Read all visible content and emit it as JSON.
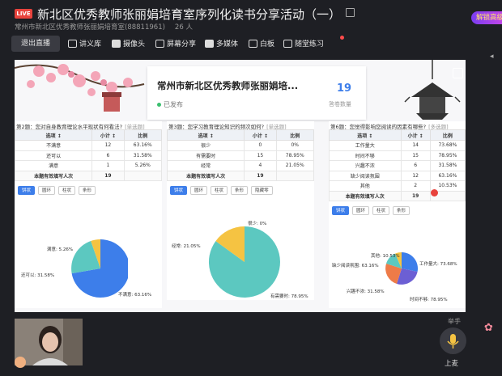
{
  "header": {
    "live_badge": "LIVE",
    "title": "新北区优秀教师张丽娟培育室序列化读书分享活动（一）",
    "room_name": "常州市新北区优秀教师张丽娟培育室",
    "room_id": "(88811961)",
    "viewer_count": "26 人",
    "promo_label": "解锁高级"
  },
  "toolbar": {
    "exit_label": "退出直播",
    "items": [
      {
        "label": "讲义库",
        "icon": "document-icon"
      },
      {
        "label": "摄像头",
        "icon": "camera-icon"
      },
      {
        "label": "屏幕分享",
        "icon": "screen-share-icon"
      },
      {
        "label": "多媒体",
        "icon": "play-icon"
      },
      {
        "label": "白板",
        "icon": "whiteboard-icon"
      },
      {
        "label": "随堂练习",
        "icon": "exercise-icon"
      }
    ]
  },
  "slide": {
    "card_title": "常州市新北区优秀教师张丽娟培...",
    "card_status": "已发布",
    "answer_count": "19",
    "answer_count_label": "答卷数量"
  },
  "questions": [
    {
      "title": "第2题：您对自身教育理论水平现状有何看法?",
      "tag": "[单选题]",
      "headers": [
        "选项 ↕",
        "小计 ↕",
        "比例"
      ],
      "rows": [
        [
          "不满意",
          "12",
          "63.16%"
        ],
        [
          "还可以",
          "6",
          "31.58%"
        ],
        [
          "满意",
          "1",
          "5.26%"
        ]
      ],
      "total_label": "本题有效填写人次",
      "total": "19",
      "chart_buttons": [
        "饼状",
        "圆环",
        "柱状",
        "条形"
      ],
      "pie_labels": [
        "满意: 5.26%",
        "还可以: 31.58%",
        "不满意: 63.16%"
      ]
    },
    {
      "title": "第3题：您学习教育理论知识的频次如何?",
      "tag": "[单选题]",
      "headers": [
        "选项 ↕",
        "小计 ↕",
        "比例"
      ],
      "rows": [
        [
          "很少",
          "0",
          "0%"
        ],
        [
          "有需要时",
          "15",
          "78.95%"
        ],
        [
          "经常",
          "4",
          "21.05%"
        ]
      ],
      "total_label": "本题有效填写人次",
      "total": "19",
      "chart_buttons": [
        "饼状",
        "圆环",
        "柱状",
        "条形",
        "隐藏零"
      ],
      "pie_labels": [
        "很少: 0%",
        "经常: 21.05%",
        "有需要时: 78.95%"
      ]
    },
    {
      "title": "第6题：您觉得影响您阅读的因素有哪些?",
      "tag": "[多选题]",
      "headers": [
        "选项 ↕",
        "小计 ↕",
        "比例"
      ],
      "rows": [
        [
          "工作量大",
          "14",
          "73.68%"
        ],
        [
          "时间不够",
          "15",
          "78.95%"
        ],
        [
          "兴趣不浓",
          "6",
          "31.58%"
        ],
        [
          "缺少阅读氛围",
          "12",
          "63.16%"
        ],
        [
          "其他",
          "2",
          "10.53%"
        ]
      ],
      "total_label": "本题有效填写人次",
      "total": "19",
      "chart_buttons": [
        "饼状",
        "圆环",
        "柱状",
        "条形"
      ],
      "pie_labels": [
        "其他: 10.53%",
        "缺少阅读氛围: 63.16%",
        "兴趣不浓: 31.58%",
        "工作量大: 73.68%",
        "时间不够: 78.95%"
      ]
    }
  ],
  "footer": {
    "raise_hand_label": "举手",
    "mic_label": "上麦"
  },
  "colors": {
    "accent": "#3d7eea",
    "pie_blue": "#3d7eea",
    "pie_teal": "#5cc8c0",
    "pie_yellow": "#f5c342",
    "pie_orange": "#ee7b48",
    "pie_purple": "#6c5fd4",
    "live_red": "#e8433d"
  }
}
